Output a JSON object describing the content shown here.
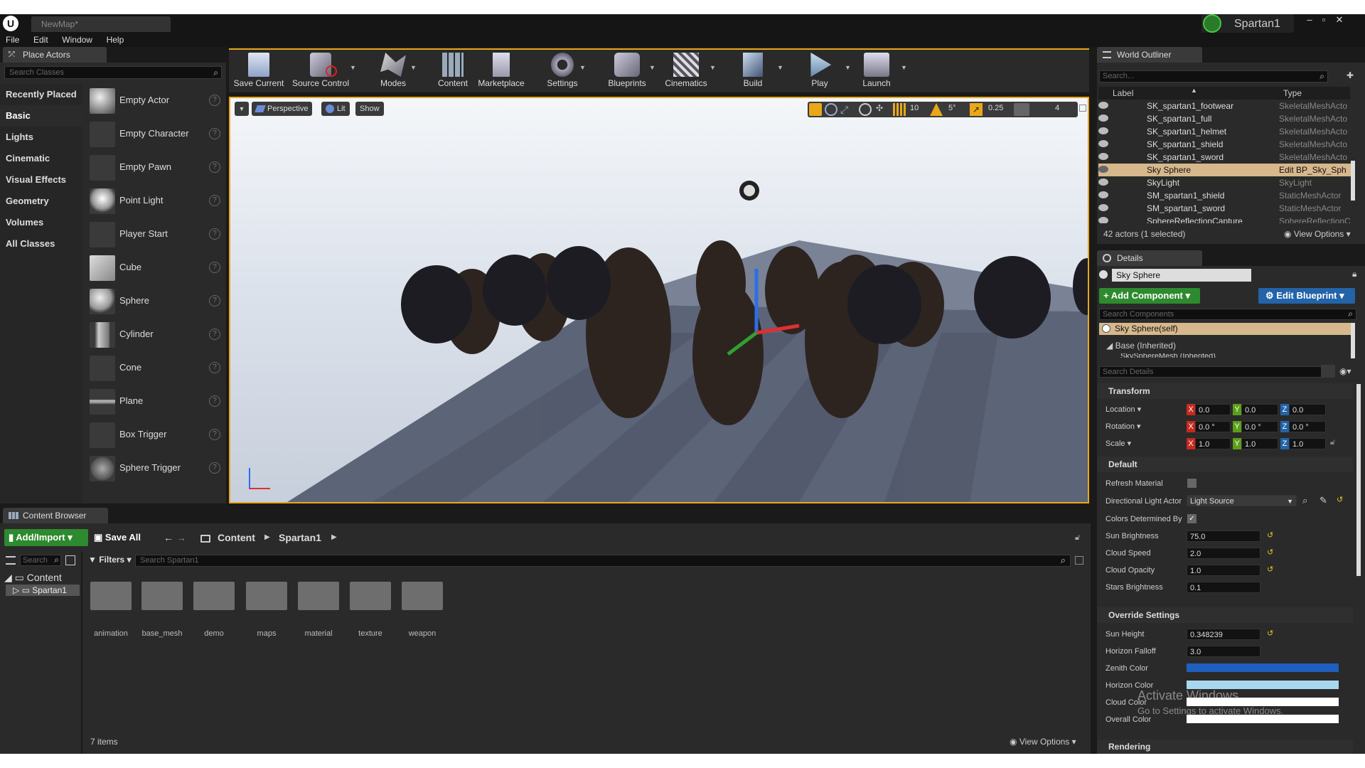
{
  "window": {
    "tab_title": "NewMap*",
    "project": "Spartan1"
  },
  "menu": [
    "File",
    "Edit",
    "Window",
    "Help"
  ],
  "place_actors": {
    "tab": "Place Actors",
    "search_placeholder": "Search Classes",
    "categories": [
      "Recently Placed",
      "Basic",
      "Lights",
      "Cinematic",
      "Visual Effects",
      "Geometry",
      "Volumes",
      "All Classes"
    ],
    "items": [
      "Empty Actor",
      "Empty Character",
      "Empty Pawn",
      "Point Light",
      "Player Start",
      "Cube",
      "Sphere",
      "Cylinder",
      "Cone",
      "Plane",
      "Box Trigger",
      "Sphere Trigger"
    ],
    "help_glyph": "?"
  },
  "toolbar": [
    "Save Current",
    "Source Control",
    "Modes",
    "Content",
    "Marketplace",
    "Settings",
    "Blueprints",
    "Cinematics",
    "Build",
    "Play",
    "Launch"
  ],
  "viewport": {
    "perspective": "Perspective",
    "lit": "Lit",
    "show": "Show",
    "grid_snap": "10",
    "rot_snap": "5°",
    "scale_snap": "0.25",
    "cam_speed": "4"
  },
  "outliner": {
    "tab": "World Outliner",
    "search_placeholder": "Search...",
    "col_label": "Label",
    "col_type": "Type",
    "rows": [
      {
        "label": "SK_spartan1_footwear",
        "type": "SkeletalMeshActo"
      },
      {
        "label": "SK_spartan1_full",
        "type": "SkeletalMeshActo"
      },
      {
        "label": "SK_spartan1_helmet",
        "type": "SkeletalMeshActo"
      },
      {
        "label": "SK_spartan1_shield",
        "type": "SkeletalMeshActo"
      },
      {
        "label": "SK_spartan1_sword",
        "type": "SkeletalMeshActo"
      },
      {
        "label": "Sky Sphere",
        "type": "Edit BP_Sky_Sph"
      },
      {
        "label": "SkyLight",
        "type": "SkyLight"
      },
      {
        "label": "SM_spartan1_shield",
        "type": "StaticMeshActor"
      },
      {
        "label": "SM_spartan1_sword",
        "type": "StaticMeshActor"
      },
      {
        "label": "SphereReflectionCapture",
        "type": "SphereReflectionC"
      }
    ],
    "status": "42 actors (1 selected)",
    "view_options": "View Options"
  },
  "details": {
    "tab": "Details",
    "name": "Sky Sphere",
    "add_component": "+ Add Component",
    "edit_blueprint": "Edit Blueprint",
    "search_components": "Search Components",
    "self_row": "Sky Sphere(self)",
    "base_row": "Base (Inherited)",
    "mesh_row": "SkySphereMesh (Inherited)",
    "search_details": "Search Details",
    "transform": {
      "title": "Transform",
      "location_label": "Location",
      "rotation_label": "Rotation",
      "scale_label": "Scale",
      "location": [
        "0.0",
        "0.0",
        "0.0"
      ],
      "rotation": [
        "0.0 °",
        "0.0 °",
        "0.0 °"
      ],
      "scale": [
        "1.0",
        "1.0",
        "1.0"
      ],
      "axes": [
        "X",
        "Y",
        "Z"
      ]
    },
    "default": {
      "title": "Default",
      "refresh_material": "Refresh Material",
      "directional_light": "Directional Light Actor",
      "light_value": "Light Source",
      "colors_determined": "Colors Determined By",
      "sun_brightness_label": "Sun Brightness",
      "sun_brightness": "75.0",
      "cloud_speed_label": "Cloud Speed",
      "cloud_speed": "2.0",
      "cloud_opacity_label": "Cloud Opacity",
      "cloud_opacity": "1.0",
      "stars_label": "Stars Brightness",
      "stars": "0.1"
    },
    "override": {
      "title": "Override Settings",
      "sun_height_label": "Sun Height",
      "sun_height": "0.348239",
      "horizon_falloff_label": "Horizon Falloff",
      "horizon_falloff": "3.0",
      "zenith_label": "Zenith Color",
      "horizon_label": "Horizon Color",
      "cloud_label": "Cloud Color",
      "overall_label": "Overall Color"
    },
    "rendering": "Rendering",
    "colors": {
      "zenith": "#1f5fbf",
      "horizon": "#a8d8f0",
      "cloud": "#ffffff",
      "overall": "#ffffff"
    }
  },
  "content_browser": {
    "tab": "Content Browser",
    "add_import": "Add/Import",
    "save_all": "Save All",
    "path": [
      "Content",
      "Spartan1"
    ],
    "search_placeholder": "Search",
    "filters": "Filters",
    "search_spartan": "Search Spartan1",
    "tree_root": "Content",
    "tree_child": "Spartan1",
    "folders": [
      "animation",
      "base_mesh",
      "demo",
      "maps",
      "material",
      "texture",
      "weapon"
    ],
    "count": "7 items",
    "view_options": "View Options"
  },
  "watermark": {
    "line1": "Activate Windows",
    "line2": "Go to Settings to activate Windows."
  }
}
